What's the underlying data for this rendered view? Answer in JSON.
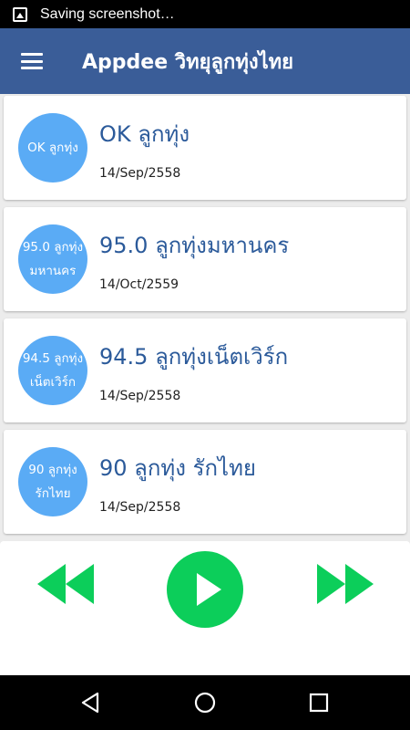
{
  "status_bar": {
    "notification_icon": "image-icon",
    "text": "Saving screenshot…"
  },
  "app_bar": {
    "menu_icon": "hamburger-menu-icon",
    "title": "Appdee วิทยุลูกทุ่งไทย",
    "color": "#3a5d98"
  },
  "stations": [
    {
      "logo_line1": "OK ลูกทุ่ง",
      "logo_line2": "",
      "name": "OK ลูกทุ่ง",
      "date": "14/Sep/2558"
    },
    {
      "logo_line1": "95.0 ลูกทุ่ง",
      "logo_line2": "มหานคร",
      "name": "95.0 ลูกทุ่งมหานคร",
      "date": "14/Oct/2559"
    },
    {
      "logo_line1": "94.5 ลูกทุ่ง",
      "logo_line2": "เน็ตเวิร์ก",
      "name": "94.5 ลูกทุ่งเน็ตเวิร์ก",
      "date": "14/Sep/2558"
    },
    {
      "logo_line1": "90 ลูกทุ่ง",
      "logo_line2": "รักไทย",
      "name": "90 ลูกทุ่ง รักไทย",
      "date": "14/Sep/2558"
    }
  ],
  "player": {
    "rewind_icon": "rewind-icon",
    "play_icon": "play-icon",
    "forward_icon": "fast-forward-icon",
    "accent": "#0cce5a"
  },
  "nav_bar": {
    "back_icon": "back-triangle-icon",
    "home_icon": "home-circle-icon",
    "recent_icon": "recent-apps-square-icon"
  },
  "colors": {
    "logo_bg": "#5aabf5",
    "station_name": "#2b5a9a"
  }
}
